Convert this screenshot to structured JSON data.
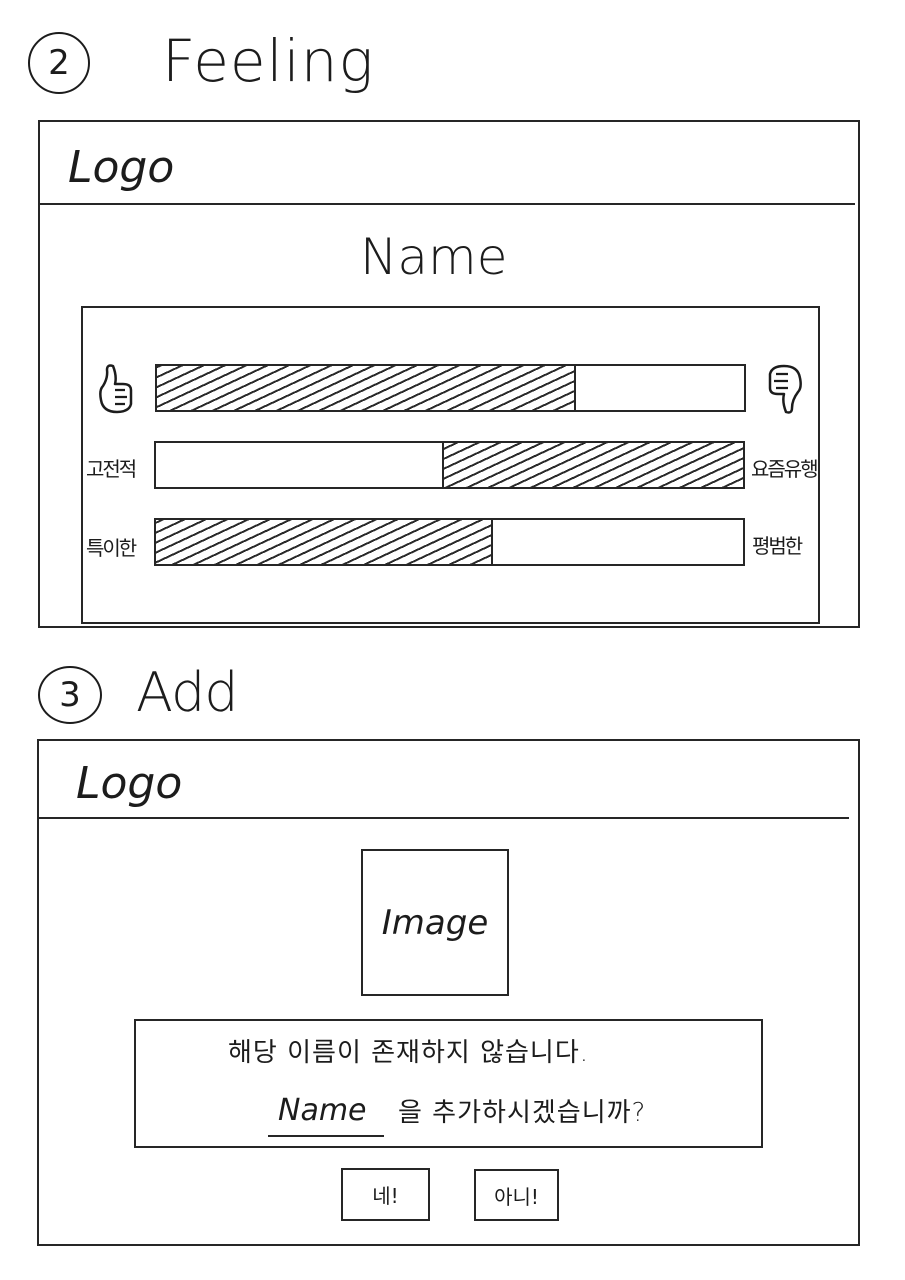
{
  "feeling": {
    "number": "2",
    "title": "Feeling",
    "logo": "Logo",
    "name": "Name",
    "rows": [
      {
        "left": "thumbs-up-icon",
        "right": "thumbs-down-icon",
        "fill_side": "left",
        "fill_fraction": 0.71
      },
      {
        "left_label": "고전적",
        "right_label": "요즘유행",
        "fill_side": "right",
        "fill_fraction": 0.51
      },
      {
        "left_label": "특이한",
        "right_label": "평범한",
        "fill_side": "left",
        "fill_fraction": 0.57
      }
    ]
  },
  "add": {
    "number": "3",
    "title": "Add",
    "logo": "Logo",
    "image_label": "Image",
    "message_line1": "해당 이름이 존재하지 않습니다.",
    "message_name": "Name",
    "message_line2_rest": "을 추가하시겠습니까?",
    "yes_button": "네!",
    "no_button": "아니!"
  }
}
